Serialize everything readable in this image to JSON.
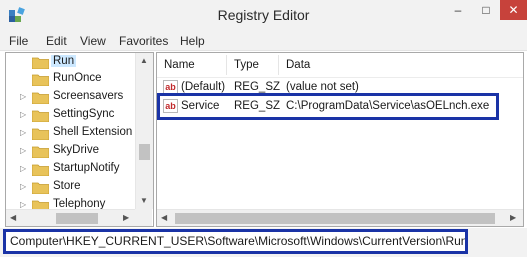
{
  "window": {
    "title": "Registry Editor",
    "controls": {
      "minimize": "–",
      "maximize": "□",
      "close": "✕"
    }
  },
  "menu": [
    "File",
    "Edit",
    "View",
    "Favorites",
    "Help"
  ],
  "tree": {
    "items": [
      {
        "label": "Run",
        "expander": "",
        "selected": true
      },
      {
        "label": "RunOnce",
        "expander": ""
      },
      {
        "label": "Screensavers",
        "expander": "▷"
      },
      {
        "label": "SettingSync",
        "expander": "▷"
      },
      {
        "label": "Shell Extension",
        "expander": "▷"
      },
      {
        "label": "SkyDrive",
        "expander": "▷"
      },
      {
        "label": "StartupNotify",
        "expander": "▷"
      },
      {
        "label": "Store",
        "expander": "▷"
      },
      {
        "label": "Telephony",
        "expander": "▷"
      }
    ]
  },
  "values": {
    "columns": [
      "Name",
      "Type",
      "Data"
    ],
    "rows": [
      {
        "name": "(Default)",
        "type": "REG_SZ",
        "data": "(value not set)"
      },
      {
        "name": "Service",
        "type": "REG_SZ",
        "data": "C:\\ProgramData\\Service\\asOELnch.exe"
      }
    ]
  },
  "status": {
    "path": "Computer\\HKEY_CURRENT_USER\\Software\\Microsoft\\Windows\\CurrentVersion\\Run"
  },
  "icons": {
    "app": "registry-editor-icon",
    "folder": "folder-icon",
    "value": "string-value-ab-icon",
    "ab_text": "ab"
  },
  "colors": {
    "highlight_border": "#1a33a6",
    "close_button": "#c7423b",
    "selection": "#cce8ff",
    "folder": "#e8c35a"
  }
}
